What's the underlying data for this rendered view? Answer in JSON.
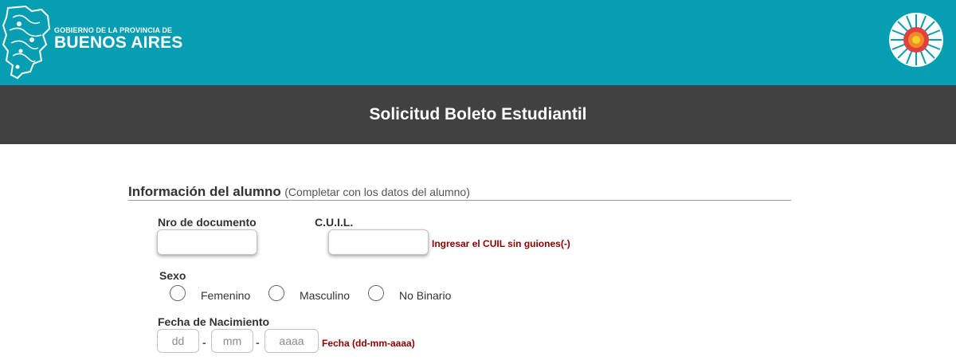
{
  "header": {
    "logo_line1": "GOBIERNO DE LA PROVINCIA DE",
    "logo_line2": "BUENOS AIRES",
    "left_logo_icon": "province-map-logo",
    "right_logo_icon": "sun-emblem-logo",
    "colors": {
      "topbar": "#069eb2",
      "titlebar": "#414141"
    }
  },
  "page": {
    "title": "Solicitud Boleto Estudiantil"
  },
  "section": {
    "title": "Información del alumno",
    "note": "(Completar con los datos del alumno)"
  },
  "fields": {
    "documento": {
      "label": "Nro de documento",
      "value": ""
    },
    "cuil": {
      "label": "C.U.I.L.",
      "value": "",
      "hint": "Ingresar el CUIL sin guiones(-)"
    },
    "sexo": {
      "label": "Sexo",
      "options": [
        "Femenino",
        "Masculino",
        "No Binario"
      ]
    },
    "fecha": {
      "label": "Fecha de Nacimiento",
      "placeholders": {
        "day": "dd",
        "month": "mm",
        "year": "aaaa"
      },
      "separator": "-",
      "hint": "Fecha (dd-mm-aaaa)"
    }
  },
  "colors": {
    "hint": "#8b0000"
  }
}
